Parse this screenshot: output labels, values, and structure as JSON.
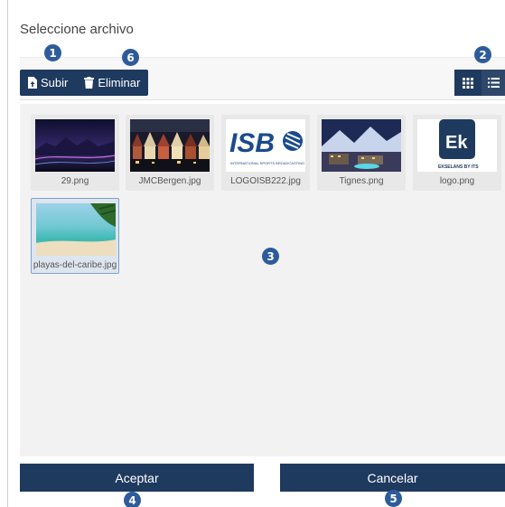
{
  "dialog": {
    "title": "Seleccione archivo"
  },
  "toolbar": {
    "upload_label": "Subir",
    "delete_label": "Eliminar",
    "grid_view_icon": "grid-icon",
    "list_view_icon": "list-icon"
  },
  "files": [
    {
      "name": "29.png",
      "thumb": "mountain-night-thumbnail"
    },
    {
      "name": "JMCBergen.jpg",
      "thumb": "bergen-houses-thumbnail"
    },
    {
      "name": "LOGOISB222.jpg",
      "thumb": "isb-logo-thumbnail",
      "logo_text": "ISB",
      "logo_sub": "INTERNATIONAL SPORTS BROADCASTING"
    },
    {
      "name": "Tignes.png",
      "thumb": "tignes-resort-thumbnail"
    },
    {
      "name": "logo.png",
      "thumb": "ek-logo-thumbnail",
      "logo_text": "Ek",
      "logo_sub": "EKSELANS BY ITS"
    },
    {
      "name": "playas-del-caribe.jpg",
      "thumb": "caribbean-beach-thumbnail",
      "selected": true
    }
  ],
  "footer": {
    "accept_label": "Aceptar",
    "cancel_label": "Cancelar"
  },
  "callouts": [
    "1",
    "2",
    "3",
    "4",
    "5",
    "6"
  ],
  "colors": {
    "primary": "#1f3a5f",
    "badge": "#2e5c9a",
    "panel": "#f2f2f2"
  }
}
